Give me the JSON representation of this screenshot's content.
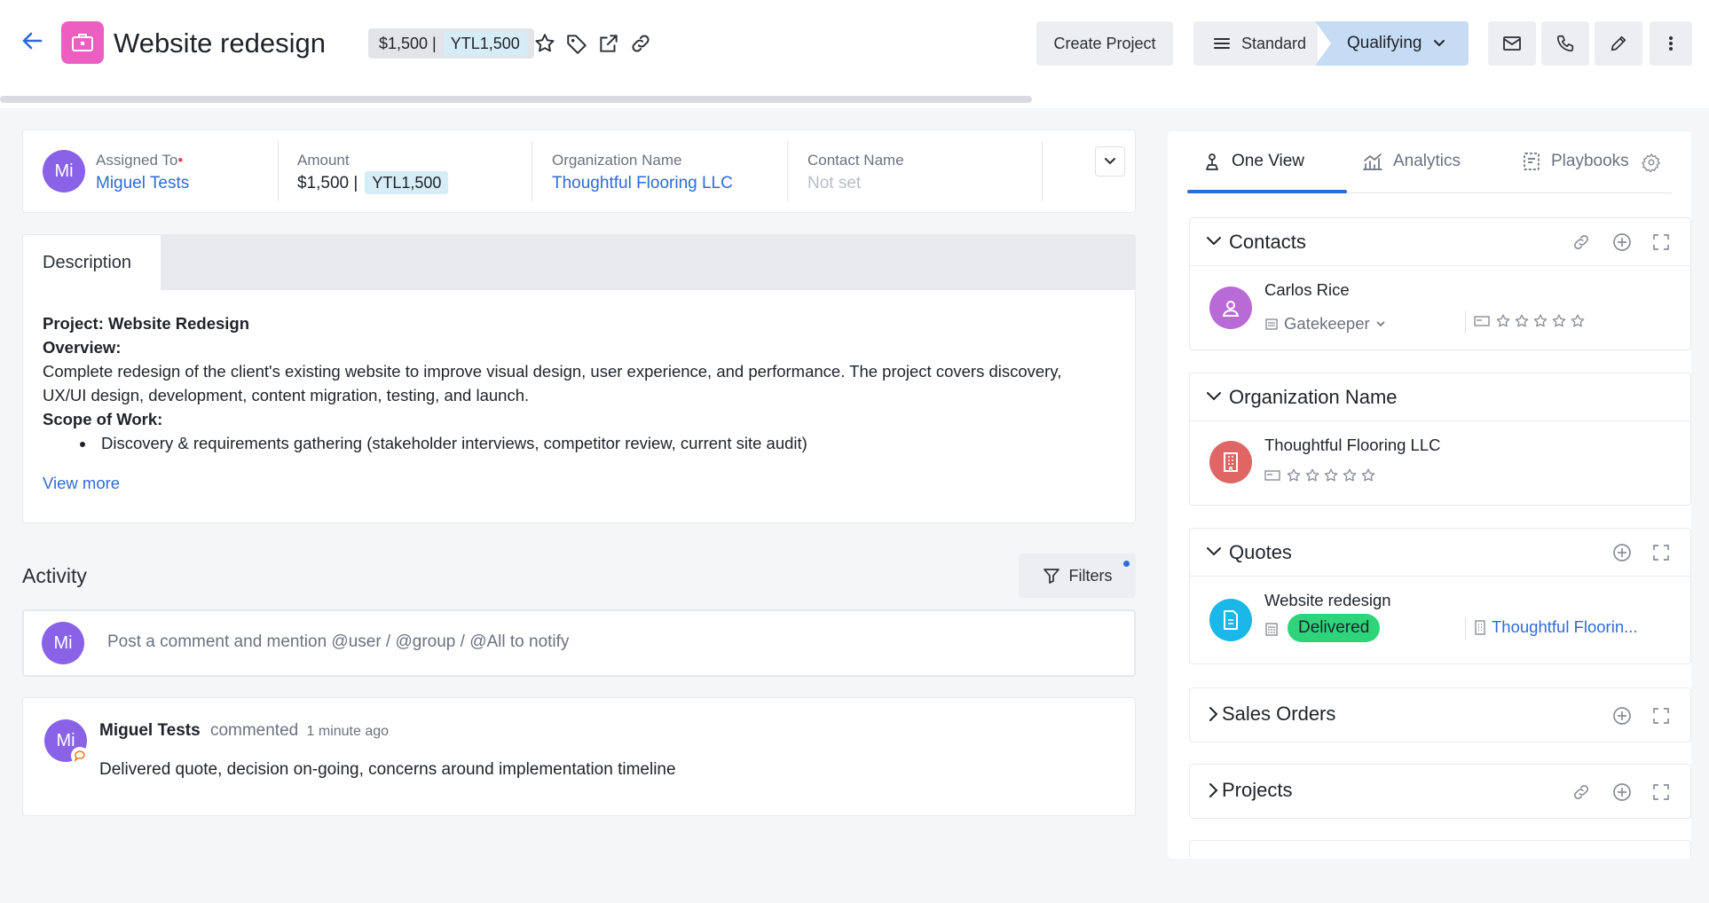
{
  "header": {
    "title": "Website redesign",
    "amount": "$1,500 |",
    "amount_ytl": "YTL1,500",
    "create_project_label": "Create Project",
    "pipeline_label": "Standard",
    "stage_label": "Qualifying"
  },
  "info": {
    "assigned_to_label": "Assigned To",
    "assigned_to_value": "Miguel Tests",
    "amount_label": "Amount",
    "amount_value": "$1,500 |",
    "amount_ytl": "YTL1,500",
    "org_label": "Organization Name",
    "org_value": "Thoughtful Flooring LLC",
    "contact_label": "Contact Name",
    "contact_value": "Not set",
    "avatar_initials": "Mi"
  },
  "description": {
    "tab_label": "Description",
    "line1": "Project: Website Redesign",
    "line2": "Overview:",
    "line3": "Complete redesign of the client's existing website to improve visual design, user experience, and performance. The project covers discovery, UX/UI design, development, content migration, testing, and launch.",
    "line4": "Scope of Work:",
    "bullet1": "Discovery & requirements gathering (stakeholder interviews, competitor review, current site audit)",
    "view_more": "View more"
  },
  "activity": {
    "title": "Activity",
    "filters_label": "Filters",
    "comment_placeholder": "Post a comment and mention @user / @group / @All to notify",
    "avatar_initials": "Mi",
    "entry": {
      "author": "Miguel Tests",
      "action": "commented",
      "time": "1 minute ago",
      "text": "Delivered quote, decision on-going, concerns around implementation timeline",
      "avatar_initials": "Mi"
    }
  },
  "right_panel": {
    "tabs": [
      {
        "label": "One View"
      },
      {
        "label": "Analytics"
      },
      {
        "label": "Playbooks"
      }
    ],
    "contacts": {
      "title": "Contacts",
      "name": "Carlos Rice",
      "role": "Gatekeeper"
    },
    "organization": {
      "title": "Organization Name",
      "name": "Thoughtful Flooring LLC"
    },
    "quotes": {
      "title": "Quotes",
      "name": "Website redesign",
      "status": "Delivered",
      "org": "Thoughtful Floorin..."
    },
    "sales_orders": {
      "title": "Sales Orders"
    },
    "projects": {
      "title": "Projects"
    }
  },
  "colors": {
    "accent": "#2f6bd8",
    "project_icon": "#ec5fc0",
    "avatar": "#8a62e8",
    "stage_active": "#c6dcf5",
    "delivered": "#2ed47a",
    "contact_icon": "#b86ad6",
    "org_icon": "#e06565",
    "quote_icon": "#1ab8e8"
  }
}
